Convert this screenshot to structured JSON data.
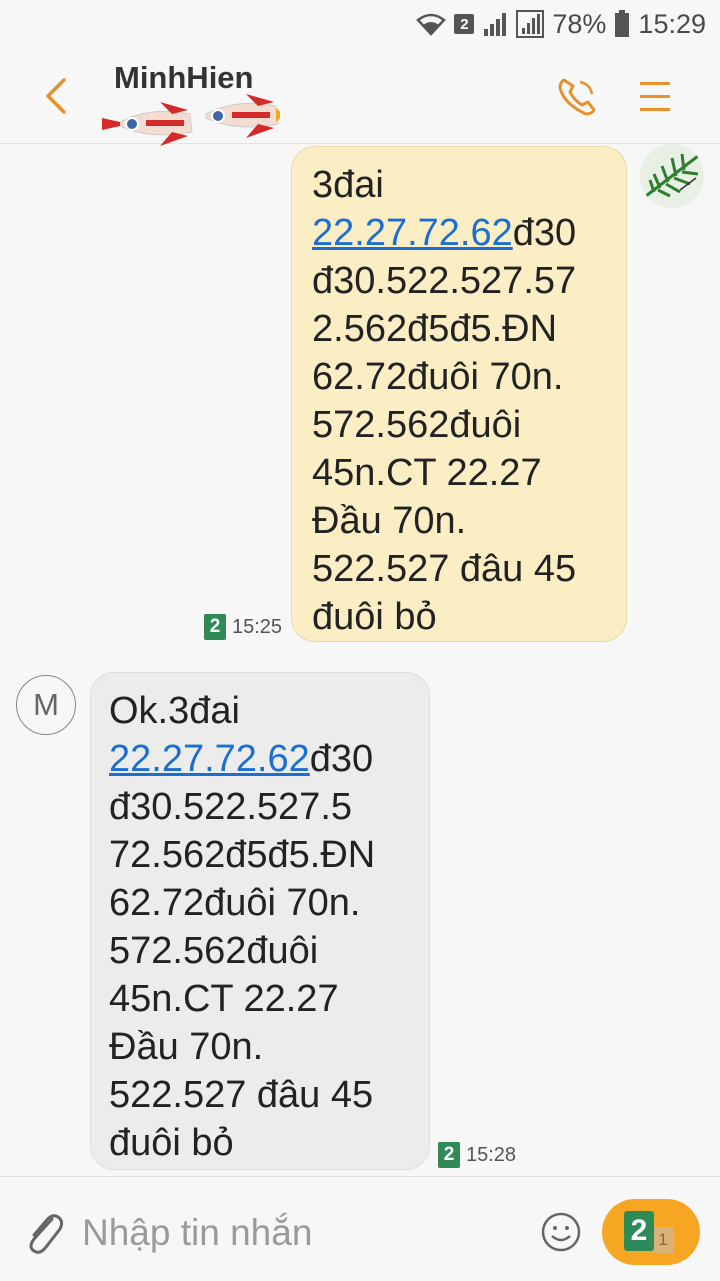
{
  "status_bar": {
    "sim_badge": "2",
    "battery": "78%",
    "time": "15:29"
  },
  "header": {
    "contact_name": "MinhHien",
    "icons": [
      "back-arrow-icon",
      "rocket-icon",
      "phone-icon",
      "menu-icon"
    ],
    "accent_color": "#e8902a"
  },
  "messages": [
    {
      "direction": "outgoing",
      "line1": "3đai",
      "link": "22.27.72.62",
      "after_link": "đ30",
      "rest": "đ30.522.527.57\n2.562đ5đ5.ĐN\n62.72đuôi 70n.\n572.562đuôi\n45n.CT 22.27\nĐầu 70n.\n522.527 đâu 45\nđuôi bỏ",
      "sim": "2",
      "time": "15:25"
    },
    {
      "direction": "incoming",
      "avatar_letter": "M",
      "line1": "Ok.3đai",
      "link": "22.27.72.62",
      "after_link": "đ30",
      "rest": "đ30.522.527.5\n72.562đ5đ5.ĐN\n62.72đuôi 70n.\n572.562đuôi\n45n.CT 22.27\nĐầu 70n.\n522.527 đâu 45\nđuôi bỏ",
      "sim": "2",
      "time": "15:28"
    }
  ],
  "composer": {
    "placeholder": "Nhập tin nhắn",
    "send_sim_primary": "2",
    "send_sim_secondary": "1",
    "send_color": "#f6a623"
  }
}
